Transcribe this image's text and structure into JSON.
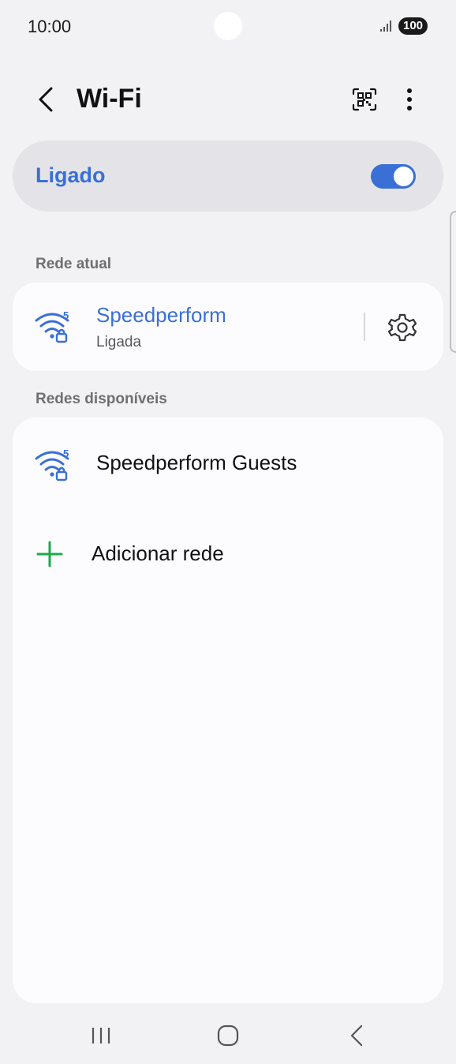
{
  "status_bar": {
    "time": "10:00",
    "battery": "100",
    "icons": [
      "signal-icon",
      "battery-icon"
    ]
  },
  "header": {
    "title": "Wi-Fi",
    "icons": [
      "back-icon",
      "qr-code-icon",
      "more-options-icon"
    ]
  },
  "master_switch": {
    "label": "Ligado",
    "on": true
  },
  "current_network": {
    "section_label": "Rede atual",
    "name": "Speedperform",
    "status": "Ligada",
    "wifi_band": "5",
    "secured": true,
    "icons": [
      "wifi-5ghz-lock-icon",
      "settings-gear-icon"
    ]
  },
  "available_networks": {
    "section_label": "Redes disponíveis",
    "items": [
      {
        "name": "Speedperform Guests",
        "wifi_band": "5",
        "secured": true
      }
    ],
    "add_network_label": "Adicionar rede"
  },
  "nav_bar": {
    "icons": [
      "recents-icon",
      "home-icon",
      "back-nav-icon"
    ]
  },
  "colors": {
    "accent": "#3a6fd6",
    "add_icon": "#1ea84a",
    "background": "#f2f2f4",
    "card": "#fcfcfe"
  }
}
